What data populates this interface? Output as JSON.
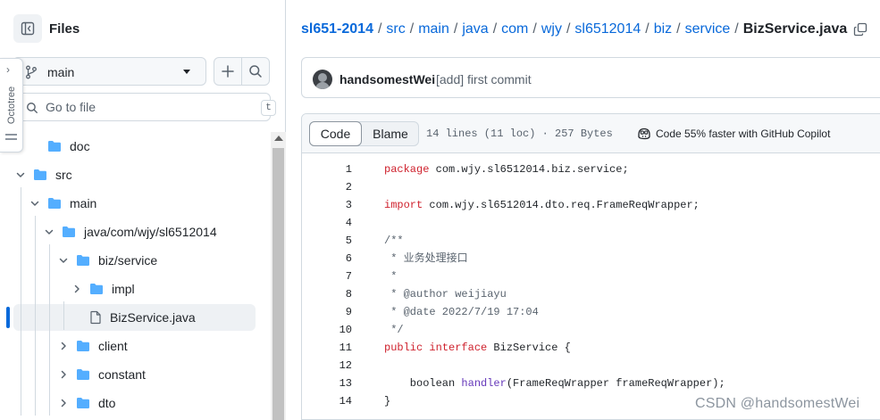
{
  "sidebar": {
    "title": "Files",
    "branch": "main",
    "goto_placeholder": "Go to file",
    "goto_shortcut": "t",
    "octotree_label": "Octotree",
    "tree": [
      {
        "label": "doc",
        "type": "folder",
        "expanded": false,
        "level": 1,
        "chevron": false
      },
      {
        "label": "src",
        "type": "folder",
        "expanded": true,
        "level": 0,
        "chevron": true
      },
      {
        "label": "main",
        "type": "folder",
        "expanded": true,
        "level": 1,
        "chevron": true
      },
      {
        "label": "java/com/wjy/sl6512014",
        "type": "folder",
        "expanded": true,
        "level": 2,
        "chevron": true
      },
      {
        "label": "biz/service",
        "type": "folder",
        "expanded": true,
        "level": 3,
        "chevron": true
      },
      {
        "label": "impl",
        "type": "folder",
        "expanded": false,
        "level": 4,
        "chevron": true
      },
      {
        "label": "BizService.java",
        "type": "file",
        "selected": true,
        "level": 4,
        "chevron": false
      },
      {
        "label": "client",
        "type": "folder",
        "expanded": false,
        "level": 3,
        "chevron": true
      },
      {
        "label": "constant",
        "type": "folder",
        "expanded": false,
        "level": 3,
        "chevron": true
      },
      {
        "label": "dto",
        "type": "folder",
        "expanded": false,
        "level": 3,
        "chevron": true
      }
    ]
  },
  "breadcrumb": {
    "repo": "sl651-2014",
    "parts": [
      "src",
      "main",
      "java",
      "com",
      "wjy",
      "sl6512014",
      "biz",
      "service"
    ],
    "separator": "/",
    "file": "BizService.java"
  },
  "commit": {
    "author": "handsomestWei",
    "message": "[add] first commit"
  },
  "file_view": {
    "tab_code": "Code",
    "tab_blame": "Blame",
    "meta": "14 lines (11 loc) · 257 Bytes",
    "copilot": "Code 55% faster with GitHub Copilot"
  },
  "code_lines": [
    [
      {
        "t": "package",
        "c": "kw"
      },
      {
        "t": " com.wjy.sl6512014.biz.service;",
        "c": ""
      }
    ],
    [],
    [
      {
        "t": "import",
        "c": "kw"
      },
      {
        "t": " com.wjy.sl6512014.dto.req.FrameReqWrapper;",
        "c": ""
      }
    ],
    [],
    [
      {
        "t": "/**",
        "c": "cm"
      }
    ],
    [
      {
        "t": " * 业务处理接口",
        "c": "cm"
      }
    ],
    [
      {
        "t": " *",
        "c": "cm"
      }
    ],
    [
      {
        "t": " * @author weijiayu",
        "c": "cm"
      }
    ],
    [
      {
        "t": " * @date 2022/7/19 17:04",
        "c": "cm"
      }
    ],
    [
      {
        "t": " */",
        "c": "cm"
      }
    ],
    [
      {
        "t": "public",
        "c": "kw"
      },
      {
        "t": " ",
        "c": ""
      },
      {
        "t": "interface",
        "c": "kw"
      },
      {
        "t": " BizService {",
        "c": ""
      }
    ],
    [],
    [
      {
        "t": "    boolean ",
        "c": ""
      },
      {
        "t": "handler",
        "c": "fn"
      },
      {
        "t": "(FrameReqWrapper frameReqWrapper);",
        "c": ""
      }
    ],
    [
      {
        "t": "}",
        "c": ""
      }
    ]
  ],
  "watermark": "CSDN @handsomestWei",
  "colors": {
    "accent": "#0969da",
    "folder": "#54aeff",
    "keyword": "#cf222e",
    "comment": "#59636e",
    "function": "#6639ba"
  }
}
